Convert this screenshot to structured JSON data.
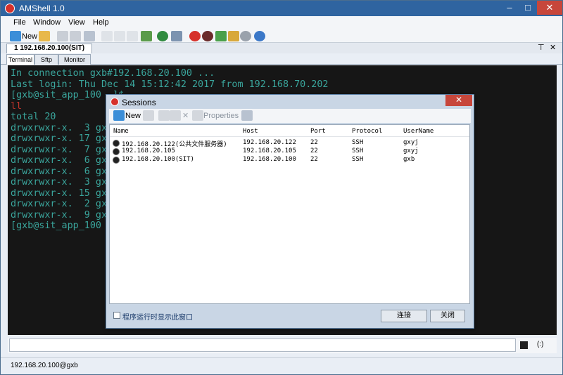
{
  "window": {
    "title": "AMShell 1.0",
    "min": "–",
    "max": "□",
    "close": "✕"
  },
  "menu": [
    "File",
    "Window",
    "View",
    "Help"
  ],
  "toolbar": {
    "new_label": "New"
  },
  "session_tab": {
    "label": "1 192.168.20.100(SIT)",
    "pin": "⊤",
    "close": "✕"
  },
  "subtabs": [
    "Terminal",
    "Sftp",
    "Monitor"
  ],
  "terminal": {
    "lines": [
      {
        "text": "In connection gxb#192.168.20.100 ...",
        "color": "normal"
      },
      {
        "text": "Last login: Thu Dec 14 15:12:42 2017 from 192.168.70.202",
        "color": "normal"
      },
      {
        "text": "[gxb@sit_app_100 ~]$",
        "color": "normal"
      },
      {
        "text": "ll",
        "color": "red"
      },
      {
        "text": "total 20",
        "color": "normal"
      },
      {
        "text": "drwxrwxr-x.  3 gx",
        "color": "normal"
      },
      {
        "text": "drwxrwxr-x. 17 gx",
        "color": "normal"
      },
      {
        "text": "drwxrwxr-x.  7 gx",
        "color": "normal"
      },
      {
        "text": "drwxrwxr-x.  6 gx",
        "color": "normal"
      },
      {
        "text": "drwxrwxr-x.  6 gx",
        "color": "normal"
      },
      {
        "text": "drwxrwxr-x.  3 gx",
        "color": "normal"
      },
      {
        "text": "drwxrwxr-x. 15 gx",
        "color": "normal"
      },
      {
        "text": "drwxrwxr-x.  2 gx",
        "color": "normal"
      },
      {
        "text": "drwxrwxr-x.  9 gx",
        "color": "normal"
      },
      {
        "text": "[gxb@sit_app_100",
        "color": "normal"
      }
    ]
  },
  "cmdbar": {
    "input_value": "",
    "mode": "(:)"
  },
  "status": {
    "text": "192.168.20.100@gxb"
  },
  "dialog": {
    "title": "Sessions",
    "close": "✕",
    "toolbar": {
      "new_label": "New",
      "properties_label": "Properties"
    },
    "columns": [
      "Name",
      "Host",
      "Port",
      "Protocol",
      "UserName"
    ],
    "rows": [
      [
        "192.168.20.122(公共文件服务器)",
        "192.168.20.122",
        "22",
        "SSH",
        "gxyj"
      ],
      [
        "192.168.20.105",
        "192.168.20.105",
        "22",
        "SSH",
        "gxyj"
      ],
      [
        "192.168.20.100(SIT)",
        "192.168.20.100",
        "22",
        "SSH",
        "gxb"
      ]
    ],
    "checkbox_label": "程序运行时显示此窗口",
    "connect_label": "连接",
    "close_label": "关闭"
  },
  "colors": {
    "titlebar": "#2f64a0",
    "terminal_bg": "#161616",
    "terminal_fg": "#3aa59c",
    "terminal_red": "#c1342b"
  }
}
